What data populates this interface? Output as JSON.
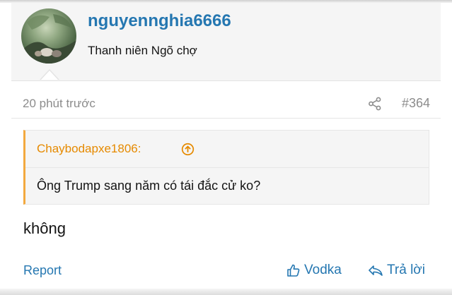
{
  "author": {
    "username": "nguyennghia6666",
    "user_title": "Thanh niên Ngõ chợ"
  },
  "post": {
    "time": "20 phút trước",
    "number": "#364",
    "message": "không"
  },
  "quote": {
    "author": "Chaybodapxe1806:",
    "text": "Ông Trump sang năm có tái đắc cử ko?"
  },
  "actions": {
    "report": "Report",
    "like": "Vodka",
    "reply": "Trả lời"
  },
  "colors": {
    "link": "#2577b1",
    "quote_accent": "#f3a93f",
    "quote_author": "#e68a00",
    "muted": "#8c8c8c"
  },
  "icons": {
    "share": "share-icon",
    "jump": "arrow-up-circle-icon",
    "like": "thumbs-up-icon",
    "reply": "reply-icon"
  }
}
